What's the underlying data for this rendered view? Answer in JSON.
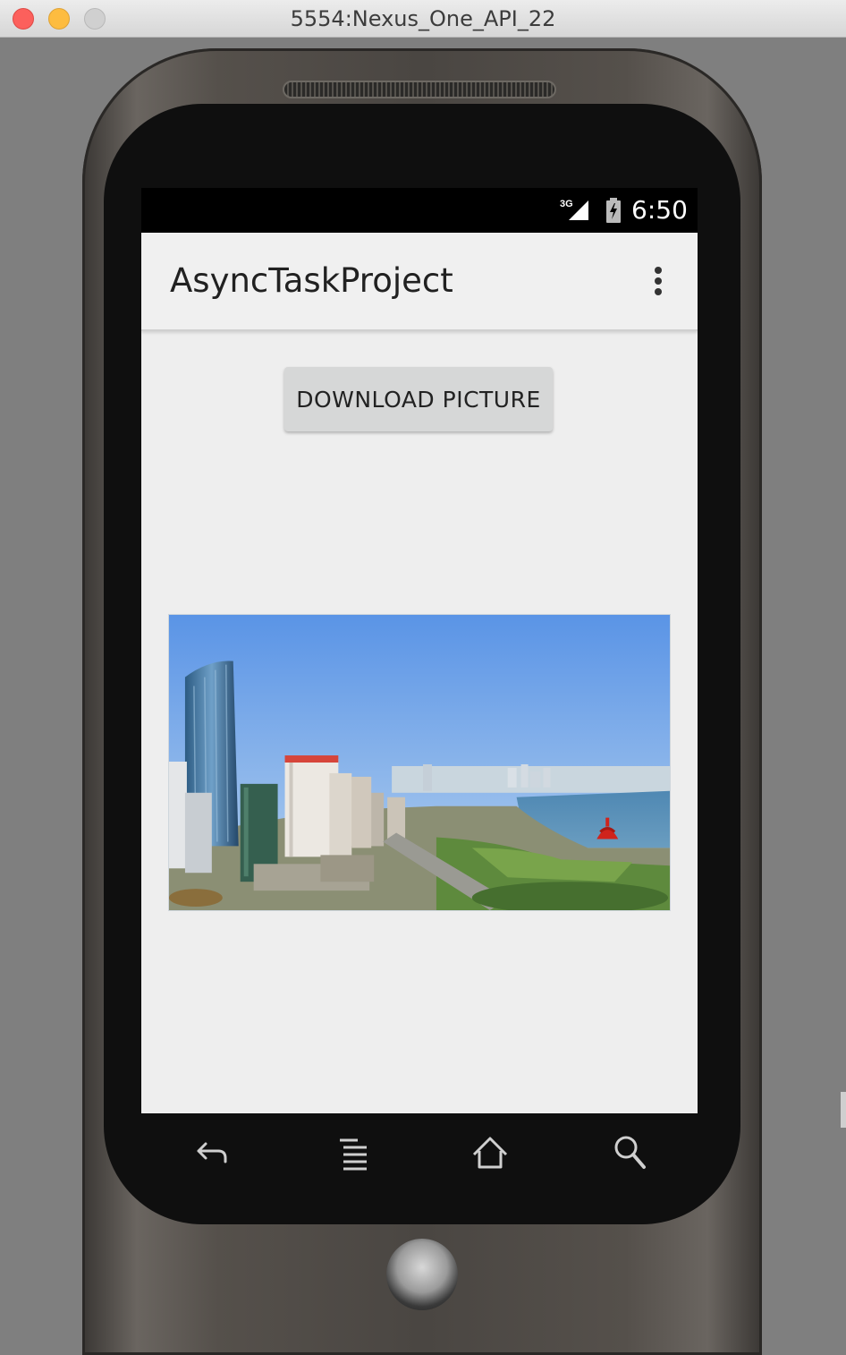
{
  "window": {
    "title": "5554:Nexus_One_API_22"
  },
  "status_bar": {
    "network_type": "3G",
    "time": "6:50"
  },
  "action_bar": {
    "title": "AsyncTaskProject"
  },
  "main": {
    "download_button_label": "DOWNLOAD PICTURE"
  },
  "colors": {
    "screen_background": "#eeeeee",
    "action_bar_background": "#f0f0f0",
    "button_background": "#d6d7d7",
    "status_bar_background": "#000000"
  },
  "icons": [
    "signal-icon",
    "battery-charging-icon",
    "overflow-menu-icon",
    "back-icon",
    "menu-icon",
    "home-icon",
    "search-icon"
  ]
}
